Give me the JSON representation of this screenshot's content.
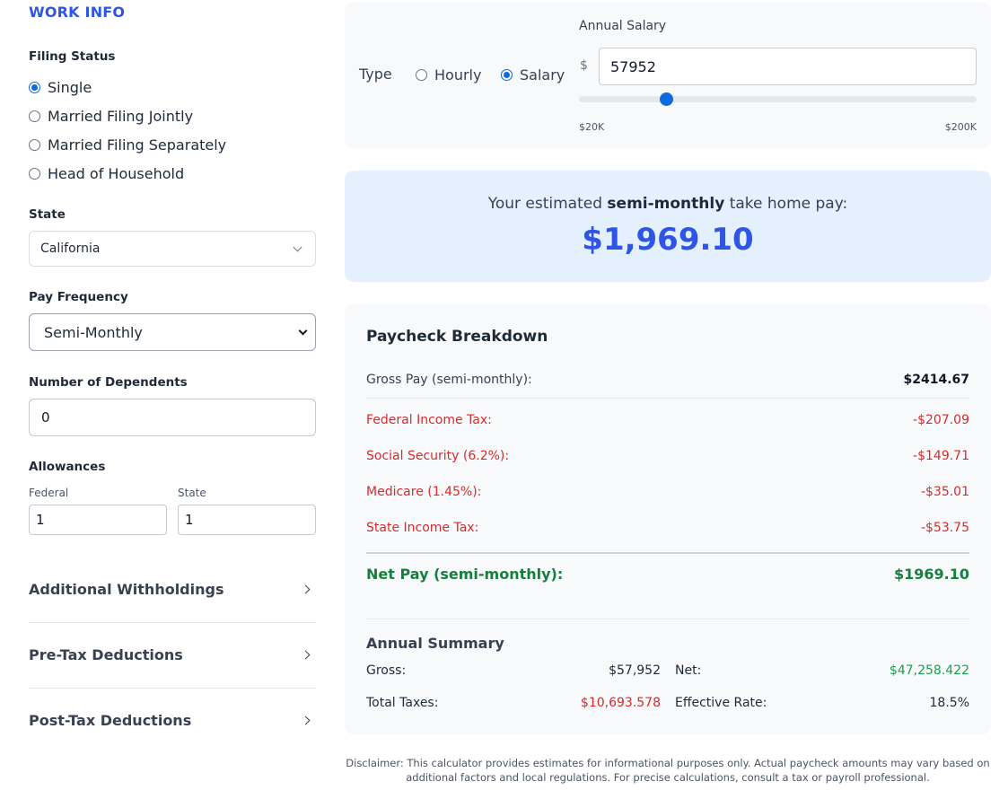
{
  "work_info": {
    "title": "WORK INFO",
    "filing_status": {
      "label": "Filing Status",
      "options": [
        "Single",
        "Married Filing Jointly",
        "Married Filing Separately",
        "Head of Household"
      ],
      "selected": "Single"
    },
    "state": {
      "label": "State",
      "value": "California"
    },
    "pay_frequency": {
      "label": "Pay Frequency",
      "value": "Semi-Monthly"
    },
    "dependents": {
      "label": "Number of Dependents",
      "value": "0"
    },
    "allowances": {
      "label": "Allowances",
      "federal_label": "Federal",
      "federal_value": "1",
      "state_label": "State",
      "state_value": "1"
    },
    "accordions": [
      "Additional Withholdings",
      "Pre-Tax Deductions",
      "Post-Tax Deductions"
    ]
  },
  "pay_type": {
    "label": "Type",
    "options": [
      "Hourly",
      "Salary"
    ],
    "selected": "Salary",
    "annual_salary_label": "Annual Salary",
    "currency_symbol": "$",
    "salary_value": "57952",
    "slider": {
      "min_label": "$20K",
      "max_label": "$200K",
      "min": 20000,
      "max": 200000,
      "value": 57952
    }
  },
  "result": {
    "prefix": "Your estimated ",
    "frequency": "semi-monthly",
    "suffix": " take home pay:",
    "amount": "$1,969.10"
  },
  "breakdown": {
    "title": "Paycheck Breakdown",
    "gross_label": "Gross Pay (semi-monthly):",
    "gross_value": "$2414.67",
    "deductions": [
      {
        "label": "Federal Income Tax:",
        "value": "-$207.09"
      },
      {
        "label": "Social Security (6.2%):",
        "value": "-$149.71"
      },
      {
        "label": "Medicare (1.45%):",
        "value": "-$35.01"
      },
      {
        "label": "State Income Tax:",
        "value": "-$53.75"
      }
    ],
    "net_label": "Net Pay (semi-monthly):",
    "net_value": "$1969.10"
  },
  "annual_summary": {
    "title": "Annual Summary",
    "gross_label": "Gross:",
    "gross_value": "$57,952",
    "net_label": "Net:",
    "net_value": "$47,258.422",
    "taxes_label": "Total Taxes:",
    "taxes_value": "$10,693.578",
    "rate_label": "Effective Rate:",
    "rate_value": "18.5%"
  },
  "disclaimer": "Disclaimer: This calculator provides estimates for informational purposes only. Actual paycheck amounts may vary based on additional factors and local regulations. For precise calculations, consult a tax or payroll professional.",
  "colors": {
    "accent": "#2f55e4",
    "radio": "#0b6bde",
    "negative": "#d72b2b",
    "positive": "#15803d",
    "result_bg": "#e5f0fe"
  }
}
